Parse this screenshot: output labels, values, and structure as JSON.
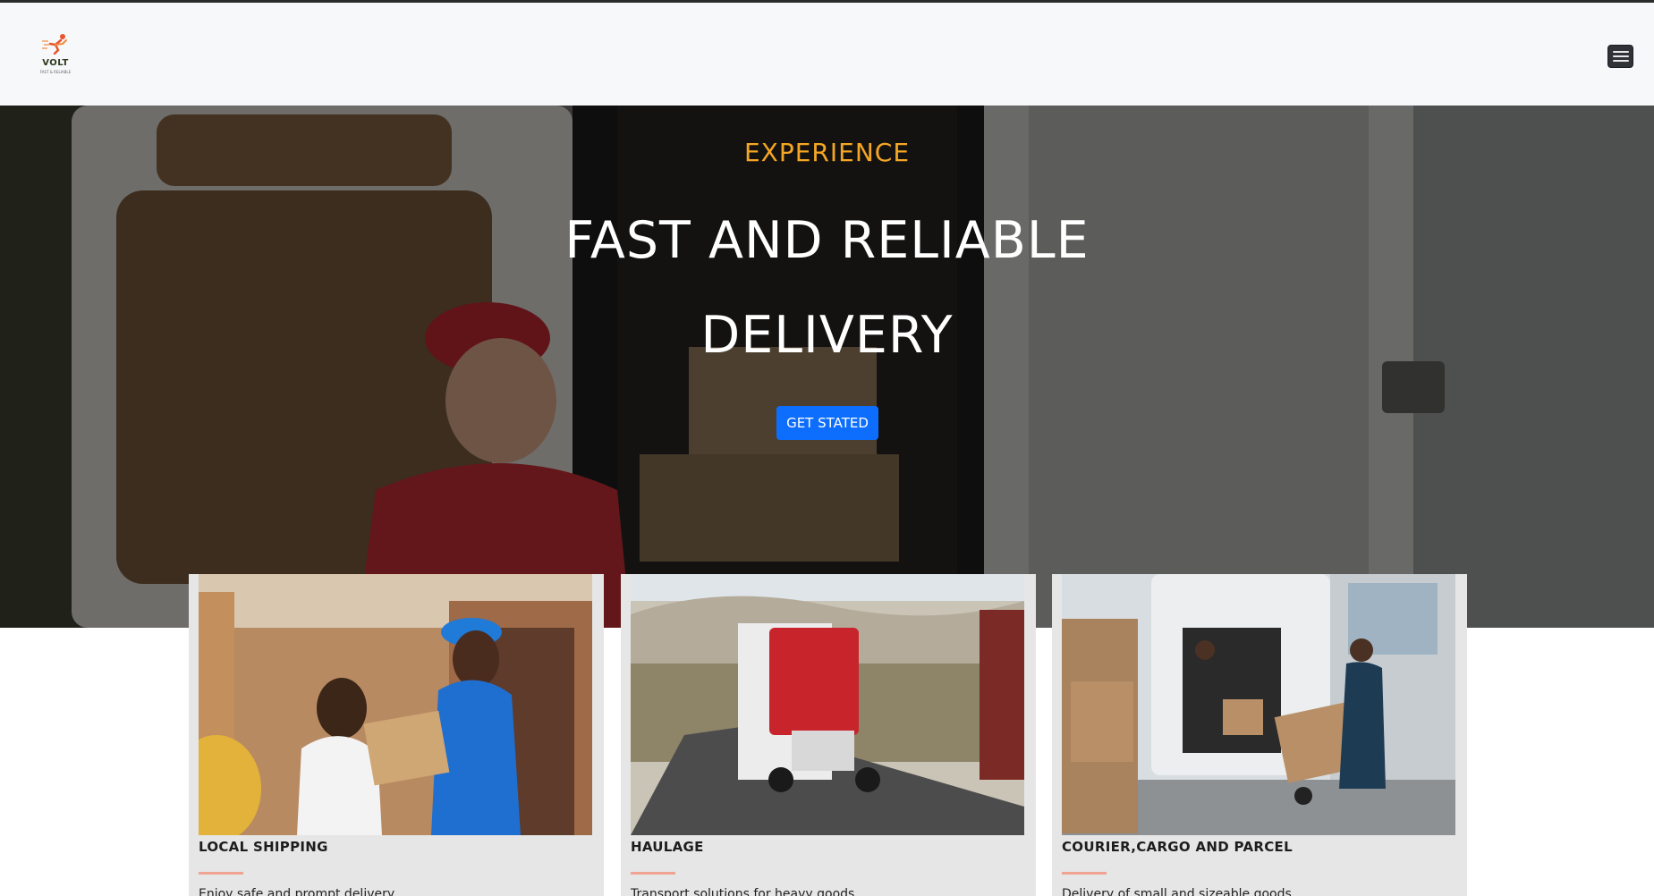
{
  "header": {
    "logo": {
      "brand": "VOLT",
      "tagline": "FAST & RELIABLE",
      "icon": "running-courier-logo"
    },
    "menu_icon": "hamburger-menu-icon"
  },
  "hero": {
    "eyebrow": "EXPERIENCE",
    "headline_line1": "FAST AND RELIABLE",
    "headline_line2": "DELIVERY",
    "cta_label": "GET STATED",
    "colors": {
      "eyebrow": "#f5a623",
      "cta": "#0d6efd"
    }
  },
  "services": [
    {
      "title": "LOCAL SHIPPING",
      "description": "Enjoy safe and prompt delivery"
    },
    {
      "title": "HAULAGE",
      "description": "Transport solutions for heavy goods"
    },
    {
      "title": "COURIER,CARGO AND PARCEL",
      "description": "Delivery of small and sizeable goods"
    }
  ]
}
